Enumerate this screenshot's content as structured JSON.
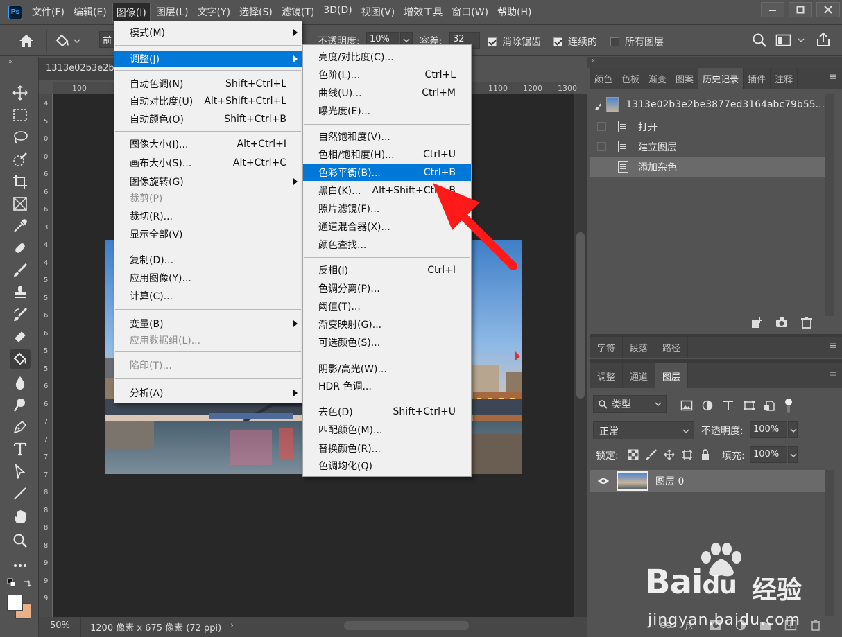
{
  "menubar": {
    "logo": "Ps",
    "items": [
      "文件(F)",
      "编辑(E)",
      "图像(I)",
      "图层(L)",
      "文字(Y)",
      "选择(S)",
      "滤镜(T)",
      "3D(D)",
      "视图(V)",
      "增效工具",
      "窗口(W)",
      "帮助(H)"
    ],
    "active_item": "图像(I)"
  },
  "options": {
    "preset_partial": "前",
    "opacity_label": "不透明度:",
    "opacity_value": "10%",
    "tolerance_label": "容差:",
    "tolerance_value": "32",
    "antialias_label": "消除锯齿",
    "antialias_checked": true,
    "contiguous_label": "连续的",
    "contiguous_checked": true,
    "all_layers_label": "所有图层",
    "all_layers_checked": false
  },
  "document": {
    "tab_title": "1313e02b3e2b",
    "ruler_top": [
      "100",
      "1100",
      "1200",
      "1300"
    ],
    "ruler_left": [
      "4",
      "5",
      "0",
      "0",
      "6",
      "6",
      "6",
      "3",
      "4",
      "4",
      "5",
      "5",
      "6",
      "6",
      "5",
      "5",
      "6",
      "6",
      "7",
      "7",
      "7",
      "7",
      "8",
      "8",
      "8",
      "8",
      "9",
      "9",
      "9"
    ],
    "zoom": "50%",
    "info": "1200 像素 x 675 像素 (72 ppi)"
  },
  "image_menu": {
    "items": [
      {
        "label": "模式(M)",
        "shortcut": "",
        "submenu": true,
        "disabled": false
      },
      {
        "label": "调整(J)",
        "shortcut": "",
        "submenu": true,
        "disabled": false,
        "highlighted": true
      },
      {
        "label": "自动色调(N)",
        "shortcut": "Shift+Ctrl+L"
      },
      {
        "label": "自动对比度(U)",
        "shortcut": "Alt+Shift+Ctrl+L"
      },
      {
        "label": "自动颜色(O)",
        "shortcut": "Shift+Ctrl+B"
      },
      {
        "label": "图像大小(I)...",
        "shortcut": "Alt+Ctrl+I"
      },
      {
        "label": "画布大小(S)...",
        "shortcut": "Alt+Ctrl+C"
      },
      {
        "label": "图像旋转(G)",
        "shortcut": "",
        "submenu": true
      },
      {
        "label": "裁剪(P)",
        "shortcut": "",
        "disabled": true
      },
      {
        "label": "裁切(R)...",
        "shortcut": ""
      },
      {
        "label": "显示全部(V)",
        "shortcut": ""
      },
      {
        "label": "复制(D)...",
        "shortcut": ""
      },
      {
        "label": "应用图像(Y)...",
        "shortcut": ""
      },
      {
        "label": "计算(C)...",
        "shortcut": ""
      },
      {
        "label": "变量(B)",
        "shortcut": "",
        "submenu": true
      },
      {
        "label": "应用数据组(L)...",
        "shortcut": "",
        "disabled": true
      },
      {
        "label": "陷印(T)...",
        "shortcut": "",
        "disabled": true
      },
      {
        "label": "分析(A)",
        "shortcut": "",
        "submenu": true
      }
    ]
  },
  "adjust_menu": {
    "items": [
      {
        "label": "亮度/对比度(C)...",
        "shortcut": ""
      },
      {
        "label": "色阶(L)...",
        "shortcut": "Ctrl+L"
      },
      {
        "label": "曲线(U)...",
        "shortcut": "Ctrl+M"
      },
      {
        "label": "曝光度(E)...",
        "shortcut": ""
      },
      {
        "label": "自然饱和度(V)...",
        "shortcut": ""
      },
      {
        "label": "色相/饱和度(H)...",
        "shortcut": "Ctrl+U"
      },
      {
        "label": "色彩平衡(B)...",
        "shortcut": "Ctrl+B",
        "highlighted": true
      },
      {
        "label": "黑白(K)...",
        "shortcut": "Alt+Shift+Ctrl+B"
      },
      {
        "label": "照片滤镜(F)...",
        "shortcut": ""
      },
      {
        "label": "通道混合器(X)...",
        "shortcut": ""
      },
      {
        "label": "颜色查找...",
        "shortcut": ""
      },
      {
        "label": "反相(I)",
        "shortcut": "Ctrl+I"
      },
      {
        "label": "色调分离(P)...",
        "shortcut": ""
      },
      {
        "label": "阈值(T)...",
        "shortcut": ""
      },
      {
        "label": "渐变映射(G)...",
        "shortcut": ""
      },
      {
        "label": "可选颜色(S)...",
        "shortcut": ""
      },
      {
        "label": "阴影/高光(W)...",
        "shortcut": ""
      },
      {
        "label": "HDR 色调...",
        "shortcut": ""
      },
      {
        "label": "去色(D)",
        "shortcut": "Shift+Ctrl+U"
      },
      {
        "label": "匹配颜色(M)...",
        "shortcut": ""
      },
      {
        "label": "替换颜色(R)...",
        "shortcut": ""
      },
      {
        "label": "色调均化(Q)",
        "shortcut": ""
      }
    ]
  },
  "history_panel": {
    "tabs": [
      "颜色",
      "色板",
      "渐变",
      "图案",
      "历史记录",
      "插件",
      "注释"
    ],
    "active_tab": "历史记录",
    "snapshot": "1313e02b3e2be3877ed3164abc79b55...",
    "steps": [
      "打开",
      "建立图层",
      "添加杂色"
    ]
  },
  "char_panel": {
    "tabs": [
      "字符",
      "段落",
      "路径"
    ]
  },
  "layers_panel": {
    "tabs": [
      "调整",
      "通道",
      "图层"
    ],
    "active_tab": "图层",
    "filter_label": "类型",
    "blend_mode": "正常",
    "opacity_label": "不透明度:",
    "opacity_value": "100%",
    "lock_label": "锁定:",
    "fill_label": "填充:",
    "fill_value": "100%",
    "layer_name": "图层 0"
  },
  "watermark": {
    "brand_a": "Bai",
    "brand_b": "du",
    "brand_cn": "经验",
    "url": "jingyan.baidu.com"
  },
  "colors": {
    "accent": "#0078d7",
    "arrow": "#ff1a1a",
    "panel": "#535353",
    "canvas": "#282828"
  }
}
